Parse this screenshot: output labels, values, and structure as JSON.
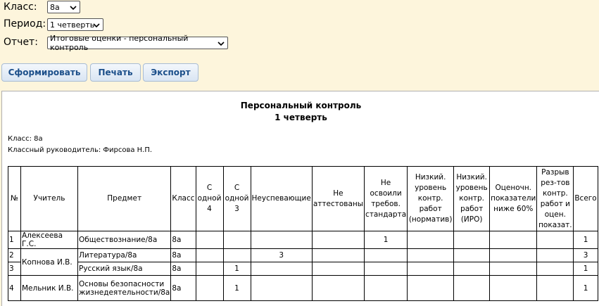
{
  "filters": {
    "class": {
      "label": "Класс:",
      "value": "8а"
    },
    "period": {
      "label": "Период:",
      "value": "1 четверть"
    },
    "report": {
      "label": "Отчет:",
      "value": "Итоговые оценки - персональный контроль"
    }
  },
  "buttons": {
    "generate": "Сформировать",
    "print": "Печать",
    "export": "Экспорт"
  },
  "report": {
    "title": "Персональный контроль",
    "subtitle": "1 четверть",
    "class_line": "Класс: 8а",
    "teacher_line": "Классный руководитель: Фирсова Н.П.",
    "headers": {
      "num": "№",
      "teacher": "Учитель",
      "subject": "Предмет",
      "class": "Класс",
      "one4": "С одной 4",
      "one3": "С одной 3",
      "failing": "Неуспевающие",
      "not_attested": "Не аттестованы",
      "not_mastered": "Не освоили требов. стандарта",
      "low_norm": "Низкий. уровень контр. работ (норматив)",
      "low_iro": "Низкий. уровень контр. работ (ИРО)",
      "below60": "Оценочн. показатели ниже 60%",
      "gap": "Разрыв рез-тов контр. работ и оцен. показат.",
      "total": "Всего"
    },
    "rows": [
      {
        "num": "1",
        "teacher": "Алексеева Г.С.",
        "subject": "Обществознание/8а",
        "class": "8а",
        "one4": "",
        "one3": "",
        "failing": "",
        "not_attested": "",
        "not_mastered": "1",
        "low_norm": "",
        "low_iro": "",
        "below60": "",
        "gap": "",
        "total": "1"
      },
      {
        "num": "2",
        "teacher": "Копнова И.В.",
        "subject": "Литература/8а",
        "class": "8а",
        "one4": "",
        "one3": "",
        "failing": "3",
        "not_attested": "",
        "not_mastered": "",
        "low_norm": "",
        "low_iro": "",
        "below60": "",
        "gap": "",
        "total": "3"
      },
      {
        "num": "3",
        "teacher": "",
        "subject": "Русский язык/8а",
        "class": "8а",
        "one4": "",
        "one3": "1",
        "failing": "",
        "not_attested": "",
        "not_mastered": "",
        "low_norm": "",
        "low_iro": "",
        "below60": "",
        "gap": "",
        "total": "1"
      },
      {
        "num": "4",
        "teacher": "Мельник И.В.",
        "subject": "Основы безопасности жизнедеятельности/8а",
        "class": "8а",
        "one4": "",
        "one3": "1",
        "failing": "",
        "not_attested": "",
        "not_mastered": "",
        "low_norm": "",
        "low_iro": "",
        "below60": "",
        "gap": "",
        "total": "1"
      }
    ]
  }
}
